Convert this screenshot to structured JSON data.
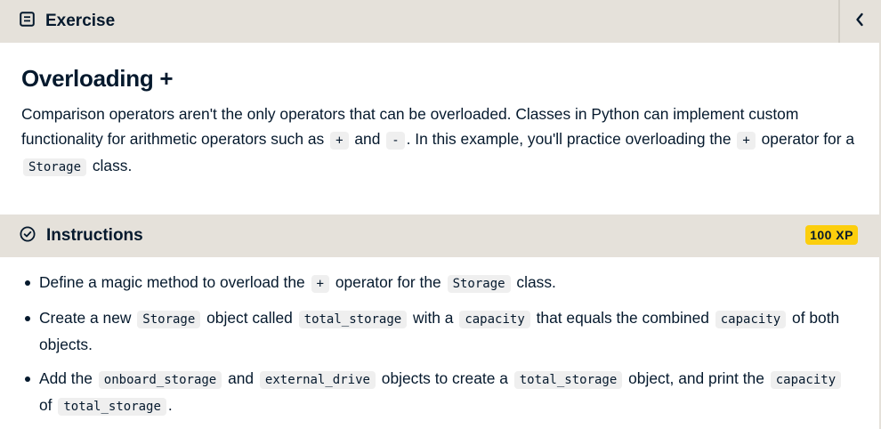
{
  "exercise": {
    "header_label": "Exercise",
    "title": "Overloading +",
    "description": [
      {
        "t": "text",
        "v": "Comparison operators aren't the only operators that can be overloaded. Classes in Python can implement custom functionality for arithmetic operators such as "
      },
      {
        "t": "code",
        "v": "+"
      },
      {
        "t": "text",
        "v": " and "
      },
      {
        "t": "code",
        "v": "-"
      },
      {
        "t": "text",
        "v": ". In this example, you'll practice overloading the "
      },
      {
        "t": "code",
        "v": "+"
      },
      {
        "t": "text",
        "v": " operator for a "
      },
      {
        "t": "code",
        "v": "Storage"
      },
      {
        "t": "text",
        "v": " class."
      }
    ]
  },
  "instructions": {
    "header_label": "Instructions",
    "xp_badge": "100 XP",
    "items": [
      [
        {
          "t": "text",
          "v": "Define a magic method to overload the "
        },
        {
          "t": "code",
          "v": "+"
        },
        {
          "t": "text",
          "v": " operator for the "
        },
        {
          "t": "code",
          "v": "Storage"
        },
        {
          "t": "text",
          "v": " class."
        }
      ],
      [
        {
          "t": "text",
          "v": "Create a new "
        },
        {
          "t": "code",
          "v": "Storage"
        },
        {
          "t": "text",
          "v": " object called "
        },
        {
          "t": "code",
          "v": "total_storage"
        },
        {
          "t": "text",
          "v": " with a "
        },
        {
          "t": "code",
          "v": "capacity"
        },
        {
          "t": "text",
          "v": " that equals the combined "
        },
        {
          "t": "code",
          "v": "capacity"
        },
        {
          "t": "text",
          "v": " of both objects."
        }
      ],
      [
        {
          "t": "text",
          "v": "Add the "
        },
        {
          "t": "code",
          "v": "onboard_storage"
        },
        {
          "t": "text",
          "v": " and "
        },
        {
          "t": "code",
          "v": "external_drive"
        },
        {
          "t": "text",
          "v": " objects to create a "
        },
        {
          "t": "code",
          "v": "total_storage"
        },
        {
          "t": "text",
          "v": " object, and print the "
        },
        {
          "t": "code",
          "v": "capacity"
        },
        {
          "t": "text",
          "v": " of "
        },
        {
          "t": "code",
          "v": "total_storage"
        },
        {
          "t": "text",
          "v": "."
        }
      ]
    ]
  },
  "icons": {
    "exercise_header": "document-icon",
    "collapse": "chevron-left-icon",
    "instructions_header": "check-circle-icon"
  },
  "colors": {
    "header_bg": "#e5e1da",
    "text": "#05192d",
    "xp_badge_bg": "#fcce0d",
    "code_bg": "#efefef"
  }
}
